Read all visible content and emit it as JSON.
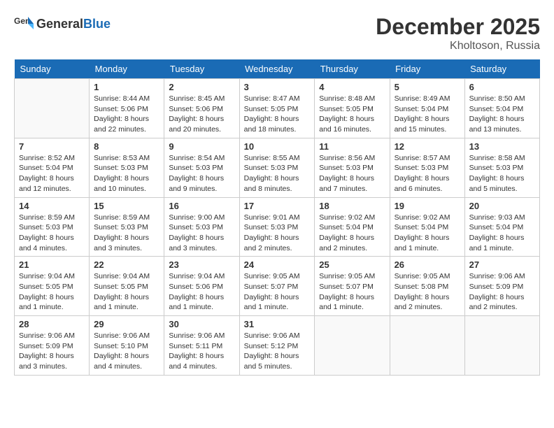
{
  "header": {
    "logo_general": "General",
    "logo_blue": "Blue",
    "title": "December 2025",
    "location": "Kholtoson, Russia"
  },
  "days_of_week": [
    "Sunday",
    "Monday",
    "Tuesday",
    "Wednesday",
    "Thursday",
    "Friday",
    "Saturday"
  ],
  "weeks": [
    [
      {
        "day": "",
        "info": ""
      },
      {
        "day": "1",
        "info": "Sunrise: 8:44 AM\nSunset: 5:06 PM\nDaylight: 8 hours\nand 22 minutes."
      },
      {
        "day": "2",
        "info": "Sunrise: 8:45 AM\nSunset: 5:06 PM\nDaylight: 8 hours\nand 20 minutes."
      },
      {
        "day": "3",
        "info": "Sunrise: 8:47 AM\nSunset: 5:05 PM\nDaylight: 8 hours\nand 18 minutes."
      },
      {
        "day": "4",
        "info": "Sunrise: 8:48 AM\nSunset: 5:05 PM\nDaylight: 8 hours\nand 16 minutes."
      },
      {
        "day": "5",
        "info": "Sunrise: 8:49 AM\nSunset: 5:04 PM\nDaylight: 8 hours\nand 15 minutes."
      },
      {
        "day": "6",
        "info": "Sunrise: 8:50 AM\nSunset: 5:04 PM\nDaylight: 8 hours\nand 13 minutes."
      }
    ],
    [
      {
        "day": "7",
        "info": "Sunrise: 8:52 AM\nSunset: 5:04 PM\nDaylight: 8 hours\nand 12 minutes."
      },
      {
        "day": "8",
        "info": "Sunrise: 8:53 AM\nSunset: 5:03 PM\nDaylight: 8 hours\nand 10 minutes."
      },
      {
        "day": "9",
        "info": "Sunrise: 8:54 AM\nSunset: 5:03 PM\nDaylight: 8 hours\nand 9 minutes."
      },
      {
        "day": "10",
        "info": "Sunrise: 8:55 AM\nSunset: 5:03 PM\nDaylight: 8 hours\nand 8 minutes."
      },
      {
        "day": "11",
        "info": "Sunrise: 8:56 AM\nSunset: 5:03 PM\nDaylight: 8 hours\nand 7 minutes."
      },
      {
        "day": "12",
        "info": "Sunrise: 8:57 AM\nSunset: 5:03 PM\nDaylight: 8 hours\nand 6 minutes."
      },
      {
        "day": "13",
        "info": "Sunrise: 8:58 AM\nSunset: 5:03 PM\nDaylight: 8 hours\nand 5 minutes."
      }
    ],
    [
      {
        "day": "14",
        "info": "Sunrise: 8:59 AM\nSunset: 5:03 PM\nDaylight: 8 hours\nand 4 minutes."
      },
      {
        "day": "15",
        "info": "Sunrise: 8:59 AM\nSunset: 5:03 PM\nDaylight: 8 hours\nand 3 minutes."
      },
      {
        "day": "16",
        "info": "Sunrise: 9:00 AM\nSunset: 5:03 PM\nDaylight: 8 hours\nand 3 minutes."
      },
      {
        "day": "17",
        "info": "Sunrise: 9:01 AM\nSunset: 5:03 PM\nDaylight: 8 hours\nand 2 minutes."
      },
      {
        "day": "18",
        "info": "Sunrise: 9:02 AM\nSunset: 5:04 PM\nDaylight: 8 hours\nand 2 minutes."
      },
      {
        "day": "19",
        "info": "Sunrise: 9:02 AM\nSunset: 5:04 PM\nDaylight: 8 hours\nand 1 minute."
      },
      {
        "day": "20",
        "info": "Sunrise: 9:03 AM\nSunset: 5:04 PM\nDaylight: 8 hours\nand 1 minute."
      }
    ],
    [
      {
        "day": "21",
        "info": "Sunrise: 9:04 AM\nSunset: 5:05 PM\nDaylight: 8 hours\nand 1 minute."
      },
      {
        "day": "22",
        "info": "Sunrise: 9:04 AM\nSunset: 5:05 PM\nDaylight: 8 hours\nand 1 minute."
      },
      {
        "day": "23",
        "info": "Sunrise: 9:04 AM\nSunset: 5:06 PM\nDaylight: 8 hours\nand 1 minute."
      },
      {
        "day": "24",
        "info": "Sunrise: 9:05 AM\nSunset: 5:07 PM\nDaylight: 8 hours\nand 1 minute."
      },
      {
        "day": "25",
        "info": "Sunrise: 9:05 AM\nSunset: 5:07 PM\nDaylight: 8 hours\nand 1 minute."
      },
      {
        "day": "26",
        "info": "Sunrise: 9:05 AM\nSunset: 5:08 PM\nDaylight: 8 hours\nand 2 minutes."
      },
      {
        "day": "27",
        "info": "Sunrise: 9:06 AM\nSunset: 5:09 PM\nDaylight: 8 hours\nand 2 minutes."
      }
    ],
    [
      {
        "day": "28",
        "info": "Sunrise: 9:06 AM\nSunset: 5:09 PM\nDaylight: 8 hours\nand 3 minutes."
      },
      {
        "day": "29",
        "info": "Sunrise: 9:06 AM\nSunset: 5:10 PM\nDaylight: 8 hours\nand 4 minutes."
      },
      {
        "day": "30",
        "info": "Sunrise: 9:06 AM\nSunset: 5:11 PM\nDaylight: 8 hours\nand 4 minutes."
      },
      {
        "day": "31",
        "info": "Sunrise: 9:06 AM\nSunset: 5:12 PM\nDaylight: 8 hours\nand 5 minutes."
      },
      {
        "day": "",
        "info": ""
      },
      {
        "day": "",
        "info": ""
      },
      {
        "day": "",
        "info": ""
      }
    ]
  ]
}
